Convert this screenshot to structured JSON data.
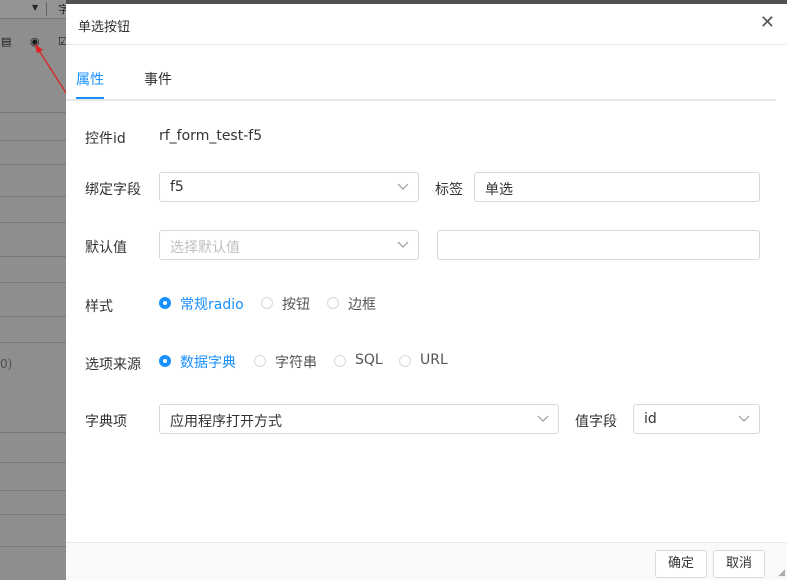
{
  "background_app": {
    "toolbar_text": "字",
    "side_text": "0)"
  },
  "dialog": {
    "title": "单选按钮",
    "close_glyph": "✕",
    "tabs": [
      {
        "label": "属性",
        "active": true
      },
      {
        "label": "事件",
        "active": false
      }
    ],
    "form": {
      "control_id": {
        "label": "控件id",
        "value": "rf_form_test-f5"
      },
      "bind_field": {
        "label": "绑定字段",
        "value": "f5"
      },
      "tag": {
        "label": "标签",
        "value": "单选"
      },
      "default_value": {
        "label": "默认值",
        "placeholder": "选择默认值",
        "extra_value": ""
      },
      "style": {
        "label": "样式",
        "options": [
          "常规radio",
          "按钮",
          "边框"
        ],
        "selected": "常规radio"
      },
      "option_source": {
        "label": "选项来源",
        "options": [
          "数据字典",
          "字符串",
          "SQL",
          "URL"
        ],
        "selected": "数据字典"
      },
      "dict_item": {
        "label": "字典项",
        "value": "应用程序打开方式"
      },
      "value_field": {
        "label": "值字段",
        "value": "id"
      }
    },
    "footer": {
      "ok_label": "确定",
      "cancel_label": "取消"
    }
  },
  "colors": {
    "accent": "#1890ff",
    "annotation_arrow": "#e02020"
  }
}
